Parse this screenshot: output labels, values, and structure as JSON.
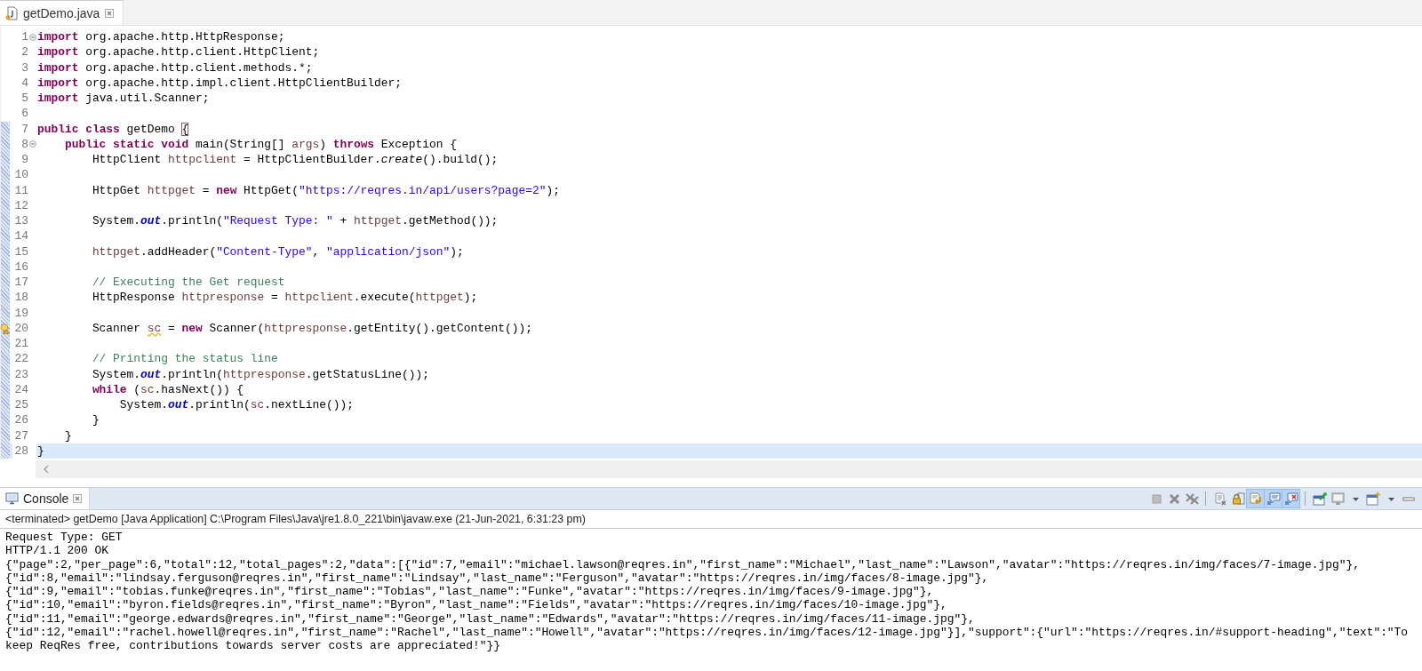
{
  "editor": {
    "tab": {
      "title": "getDemo.java",
      "selected": true
    },
    "lines": [
      {
        "number": "1",
        "fold": true,
        "in_range": false,
        "warning": false,
        "highlighted": false,
        "tokens": [
          {
            "kind": "keyword",
            "text": "import"
          },
          {
            "kind": "plain",
            "text": " org.apache.http.HttpResponse;"
          }
        ]
      },
      {
        "number": "2",
        "fold": false,
        "in_range": false,
        "warning": false,
        "highlighted": false,
        "tokens": [
          {
            "kind": "keyword",
            "text": "import"
          },
          {
            "kind": "plain",
            "text": " org.apache.http.client.HttpClient;"
          }
        ]
      },
      {
        "number": "3",
        "fold": false,
        "in_range": false,
        "warning": false,
        "highlighted": false,
        "tokens": [
          {
            "kind": "keyword",
            "text": "import"
          },
          {
            "kind": "plain",
            "text": " org.apache.http.client.methods.*;"
          }
        ]
      },
      {
        "number": "4",
        "fold": false,
        "in_range": false,
        "warning": false,
        "highlighted": false,
        "tokens": [
          {
            "kind": "keyword",
            "text": "import"
          },
          {
            "kind": "plain",
            "text": " org.apache.http.impl.client.HttpClientBuilder;"
          }
        ]
      },
      {
        "number": "5",
        "fold": false,
        "in_range": false,
        "warning": false,
        "highlighted": false,
        "tokens": [
          {
            "kind": "keyword",
            "text": "import"
          },
          {
            "kind": "plain",
            "text": " java.util.Scanner;"
          }
        ]
      },
      {
        "number": "6",
        "fold": false,
        "in_range": false,
        "warning": false,
        "highlighted": false
      },
      {
        "number": "7",
        "fold": false,
        "in_range": true,
        "warning": false,
        "highlighted": false,
        "tokens": [
          {
            "kind": "keyword",
            "text": "public"
          },
          {
            "kind": "keyword",
            "text": " class"
          },
          {
            "kind": "plain",
            "text": " getDemo "
          },
          {
            "kind": "bracket",
            "text": "{"
          }
        ]
      },
      {
        "number": "8",
        "fold": true,
        "in_range": true,
        "warning": false,
        "highlighted": false,
        "tokens": [
          {
            "kind": "keyword",
            "text": "    public"
          },
          {
            "kind": "keyword",
            "text": " static"
          },
          {
            "kind": "keyword",
            "text": " void"
          },
          {
            "kind": "plain",
            "text": " main(String[] "
          },
          {
            "kind": "variable",
            "text": "args"
          },
          {
            "kind": "plain",
            "text": ") "
          },
          {
            "kind": "keyword",
            "text": "throws"
          },
          {
            "kind": "plain",
            "text": " Exception {"
          }
        ]
      },
      {
        "number": "9",
        "fold": false,
        "in_range": true,
        "warning": false,
        "highlighted": false,
        "tokens": [
          {
            "kind": "plain",
            "text": "        HttpClient "
          },
          {
            "kind": "variable",
            "text": "httpclient"
          },
          {
            "kind": "plain",
            "text": " = HttpClientBuilder."
          },
          {
            "kind": "static",
            "text": "create"
          },
          {
            "kind": "plain",
            "text": "().build();"
          }
        ]
      },
      {
        "number": "10",
        "fold": false,
        "in_range": true,
        "warning": false,
        "highlighted": false
      },
      {
        "number": "11",
        "fold": false,
        "in_range": true,
        "warning": false,
        "highlighted": false,
        "tokens": [
          {
            "kind": "plain",
            "text": "        HttpGet "
          },
          {
            "kind": "variable",
            "text": "httpget"
          },
          {
            "kind": "plain",
            "text": " = "
          },
          {
            "kind": "keyword",
            "text": "new"
          },
          {
            "kind": "plain",
            "text": " HttpGet("
          },
          {
            "kind": "string",
            "text": "\"https://reqres.in/api/users?page=2\""
          },
          {
            "kind": "plain",
            "text": ");"
          }
        ]
      },
      {
        "number": "12",
        "fold": false,
        "in_range": true,
        "warning": false,
        "highlighted": false
      },
      {
        "number": "13",
        "fold": false,
        "in_range": true,
        "warning": false,
        "highlighted": false,
        "tokens": [
          {
            "kind": "plain",
            "text": "        System."
          },
          {
            "kind": "field",
            "text": "out"
          },
          {
            "kind": "plain",
            "text": ".println("
          },
          {
            "kind": "string",
            "text": "\"Request Type: \""
          },
          {
            "kind": "plain",
            "text": " + "
          },
          {
            "kind": "variable",
            "text": "httpget"
          },
          {
            "kind": "plain",
            "text": ".getMethod());"
          }
        ]
      },
      {
        "number": "14",
        "fold": false,
        "in_range": true,
        "warning": false,
        "highlighted": false
      },
      {
        "number": "15",
        "fold": false,
        "in_range": true,
        "warning": false,
        "highlighted": false,
        "tokens": [
          {
            "kind": "variable",
            "text": "        httpget"
          },
          {
            "kind": "plain",
            "text": ".addHeader("
          },
          {
            "kind": "string",
            "text": "\"Content-Type\""
          },
          {
            "kind": "plain",
            "text": ", "
          },
          {
            "kind": "string",
            "text": "\"application/json\""
          },
          {
            "kind": "plain",
            "text": ");"
          }
        ]
      },
      {
        "number": "16",
        "fold": false,
        "in_range": true,
        "warning": false,
        "highlighted": false
      },
      {
        "number": "17",
        "fold": false,
        "in_range": true,
        "warning": false,
        "highlighted": false,
        "tokens": [
          {
            "kind": "comment",
            "text": "        // Executing the Get request"
          }
        ]
      },
      {
        "number": "18",
        "fold": false,
        "in_range": true,
        "warning": false,
        "highlighted": false,
        "tokens": [
          {
            "kind": "plain",
            "text": "        HttpResponse "
          },
          {
            "kind": "variable",
            "text": "httpresponse"
          },
          {
            "kind": "plain",
            "text": " = "
          },
          {
            "kind": "variable",
            "text": "httpclient"
          },
          {
            "kind": "plain",
            "text": ".execute("
          },
          {
            "kind": "variable",
            "text": "httpget"
          },
          {
            "kind": "plain",
            "text": ");"
          }
        ]
      },
      {
        "number": "19",
        "fold": false,
        "in_range": true,
        "warning": false,
        "highlighted": false
      },
      {
        "number": "20",
        "fold": false,
        "in_range": true,
        "warning": true,
        "highlighted": false,
        "tokens": [
          {
            "kind": "plain",
            "text": "        Scanner "
          },
          {
            "kind": "warning-variable",
            "text": "sc"
          },
          {
            "kind": "plain",
            "text": " = "
          },
          {
            "kind": "keyword",
            "text": "new"
          },
          {
            "kind": "plain",
            "text": " Scanner("
          },
          {
            "kind": "variable",
            "text": "httpresponse"
          },
          {
            "kind": "plain",
            "text": ".getEntity().getContent());"
          }
        ]
      },
      {
        "number": "21",
        "fold": false,
        "in_range": true,
        "warning": false,
        "highlighted": false
      },
      {
        "number": "22",
        "fold": false,
        "in_range": true,
        "warning": false,
        "highlighted": false,
        "tokens": [
          {
            "kind": "comment",
            "text": "        // Printing the status line"
          }
        ]
      },
      {
        "number": "23",
        "fold": false,
        "in_range": true,
        "warning": false,
        "highlighted": false,
        "tokens": [
          {
            "kind": "plain",
            "text": "        System."
          },
          {
            "kind": "field",
            "text": "out"
          },
          {
            "kind": "plain",
            "text": ".println("
          },
          {
            "kind": "variable",
            "text": "httpresponse"
          },
          {
            "kind": "plain",
            "text": ".getStatusLine());"
          }
        ]
      },
      {
        "number": "24",
        "fold": false,
        "in_range": true,
        "warning": false,
        "highlighted": false,
        "tokens": [
          {
            "kind": "keyword",
            "text": "        while"
          },
          {
            "kind": "plain",
            "text": " ("
          },
          {
            "kind": "variable",
            "text": "sc"
          },
          {
            "kind": "plain",
            "text": ".hasNext()) {"
          }
        ]
      },
      {
        "number": "25",
        "fold": false,
        "in_range": true,
        "warning": false,
        "highlighted": false,
        "tokens": [
          {
            "kind": "plain",
            "text": "            System."
          },
          {
            "kind": "field",
            "text": "out"
          },
          {
            "kind": "plain",
            "text": ".println("
          },
          {
            "kind": "variable",
            "text": "sc"
          },
          {
            "kind": "plain",
            "text": ".nextLine());"
          }
        ]
      },
      {
        "number": "26",
        "fold": false,
        "in_range": true,
        "warning": false,
        "highlighted": false,
        "tokens": [
          {
            "kind": "plain",
            "text": "        }"
          }
        ]
      },
      {
        "number": "27",
        "fold": false,
        "in_range": true,
        "warning": false,
        "highlighted": false,
        "tokens": [
          {
            "kind": "plain",
            "text": "    }"
          }
        ]
      },
      {
        "number": "28",
        "fold": false,
        "in_range": true,
        "warning": false,
        "highlighted": true,
        "tokens": [
          {
            "kind": "plain",
            "text": "}"
          }
        ]
      }
    ]
  },
  "console": {
    "tab": {
      "title": "Console",
      "selected": true
    },
    "toolbar": [
      {
        "kind": "terminate",
        "selected": false
      },
      {
        "kind": "remove",
        "selected": false
      },
      {
        "kind": "remove-all",
        "selected": false
      },
      {
        "kind": "separator"
      },
      {
        "kind": "clear",
        "selected": false
      },
      {
        "kind": "scroll-lock",
        "selected": false
      },
      {
        "kind": "word-wrap",
        "selected": true
      },
      {
        "kind": "show-stdout",
        "selected": true
      },
      {
        "kind": "show-stderr",
        "selected": true
      },
      {
        "kind": "separator"
      },
      {
        "kind": "pin",
        "selected": false
      },
      {
        "kind": "display",
        "selected": false
      },
      {
        "kind": "dropdown",
        "selected": false
      },
      {
        "kind": "new-console",
        "selected": false
      },
      {
        "kind": "dropdown",
        "selected": false
      },
      {
        "kind": "minimize",
        "selected": false
      }
    ],
    "process": "<terminated> getDemo [Java Application] C:\\Program Files\\Java\\jre1.8.0_221\\bin\\javaw.exe (21-Jun-2021, 6:31:23 pm)",
    "output": [
      "Request Type: GET",
      "HTTP/1.1 200 OK",
      "{\"page\":2,\"per_page\":6,\"total\":12,\"total_pages\":2,\"data\":[{\"id\":7,\"email\":\"michael.lawson@reqres.in\",\"first_name\":\"Michael\",\"last_name\":\"Lawson\",\"avatar\":\"https://reqres.in/img/faces/7-image.jpg\"},",
      "{\"id\":8,\"email\":\"lindsay.ferguson@reqres.in\",\"first_name\":\"Lindsay\",\"last_name\":\"Ferguson\",\"avatar\":\"https://reqres.in/img/faces/8-image.jpg\"},",
      "{\"id\":9,\"email\":\"tobias.funke@reqres.in\",\"first_name\":\"Tobias\",\"last_name\":\"Funke\",\"avatar\":\"https://reqres.in/img/faces/9-image.jpg\"},",
      "{\"id\":10,\"email\":\"byron.fields@reqres.in\",\"first_name\":\"Byron\",\"last_name\":\"Fields\",\"avatar\":\"https://reqres.in/img/faces/10-image.jpg\"},",
      "{\"id\":11,\"email\":\"george.edwards@reqres.in\",\"first_name\":\"George\",\"last_name\":\"Edwards\",\"avatar\":\"https://reqres.in/img/faces/11-image.jpg\"},",
      "{\"id\":12,\"email\":\"rachel.howell@reqres.in\",\"first_name\":\"Rachel\",\"last_name\":\"Howell\",\"avatar\":\"https://reqres.in/img/faces/12-image.jpg\"}],\"support\":{\"url\":\"https://reqres.in/#support-heading\",\"text\":\"To",
      "keep ReqRes free, contributions towards server costs are appreciated!\"}}"
    ]
  }
}
